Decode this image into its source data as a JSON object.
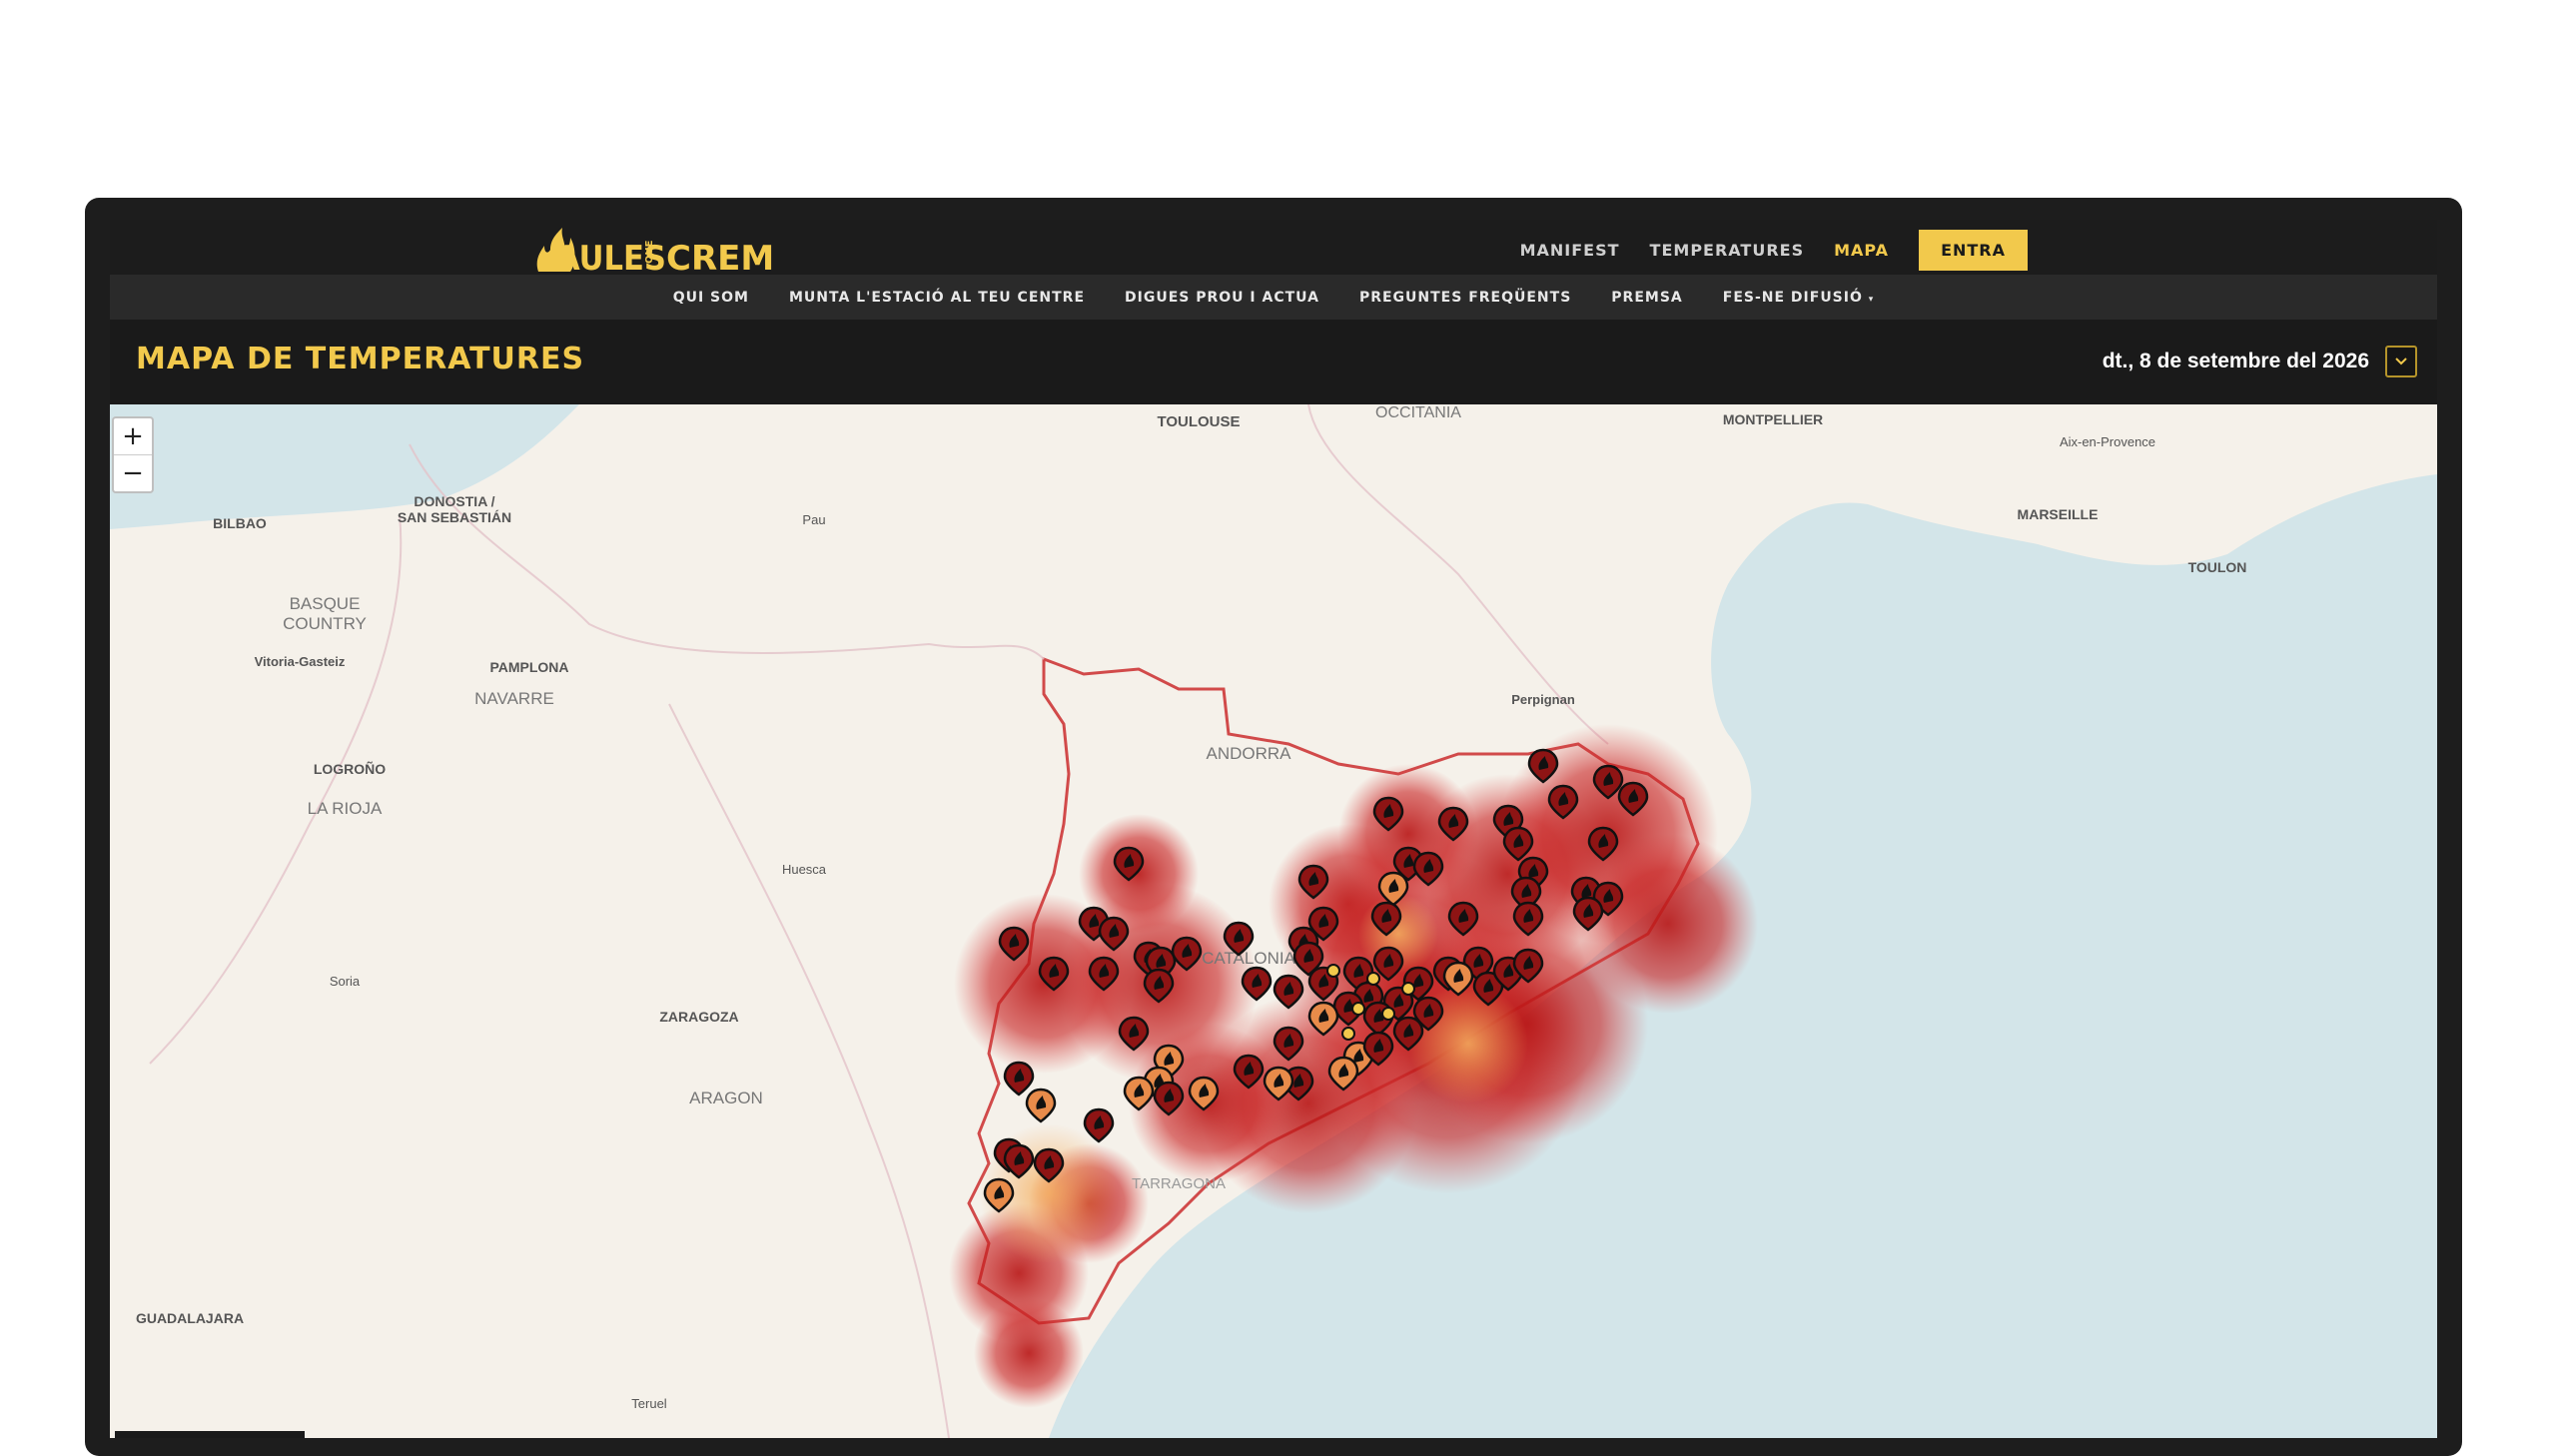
{
  "brand": {
    "logo_text_left": "AULES",
    "logo_text_small": "QUE",
    "logo_text_right": "CREMEN",
    "accent": "#f2c94c"
  },
  "nav": {
    "items": [
      {
        "label": "MANIFEST",
        "active": false
      },
      {
        "label": "TEMPERATURES",
        "active": false
      },
      {
        "label": "MAPA",
        "active": true
      }
    ],
    "entra_label": "ENTRA"
  },
  "subnav": {
    "items": [
      "QUI SOM",
      "MUNTA L'ESTACIÓ AL TEU CENTRE",
      "DIGUES PROU I ACTUA",
      "PREGUNTES FREQÜENTS",
      "PREMSA",
      "FES-NE DIFUSIÓ"
    ]
  },
  "page": {
    "title": "MAPA DE TEMPERATURES",
    "date": "dt., 8 de setembre del 2026"
  },
  "map": {
    "zoom_in": "+",
    "zoom_out": "−",
    "labels": [
      "TOULOUSE",
      "OCCITANIA",
      "MONTPELLIER",
      "Aix-en-Provence",
      "MARSEILLE",
      "TOULON",
      "BILBAO",
      "DONOSTIA /",
      "SAN SEBASTIÁN",
      "Pau",
      "BASQUE",
      "COUNTRY",
      "Vitoria-Gasteiz",
      "PAMPLONA",
      "NAVARRE",
      "LOGROÑO",
      "LA RIOJA",
      "Huesca",
      "Perpignan",
      "ANDORRA",
      "CATALONIA",
      "Soria",
      "ZARAGOZA",
      "ARAGON",
      "TARRAGONA",
      "GUADALAJARA",
      "Teruel"
    ],
    "colors": {
      "sea": "#d3e5e9",
      "land": "#f5f1ea",
      "heat": "#c41a1a",
      "warm": "#f0a050"
    }
  }
}
